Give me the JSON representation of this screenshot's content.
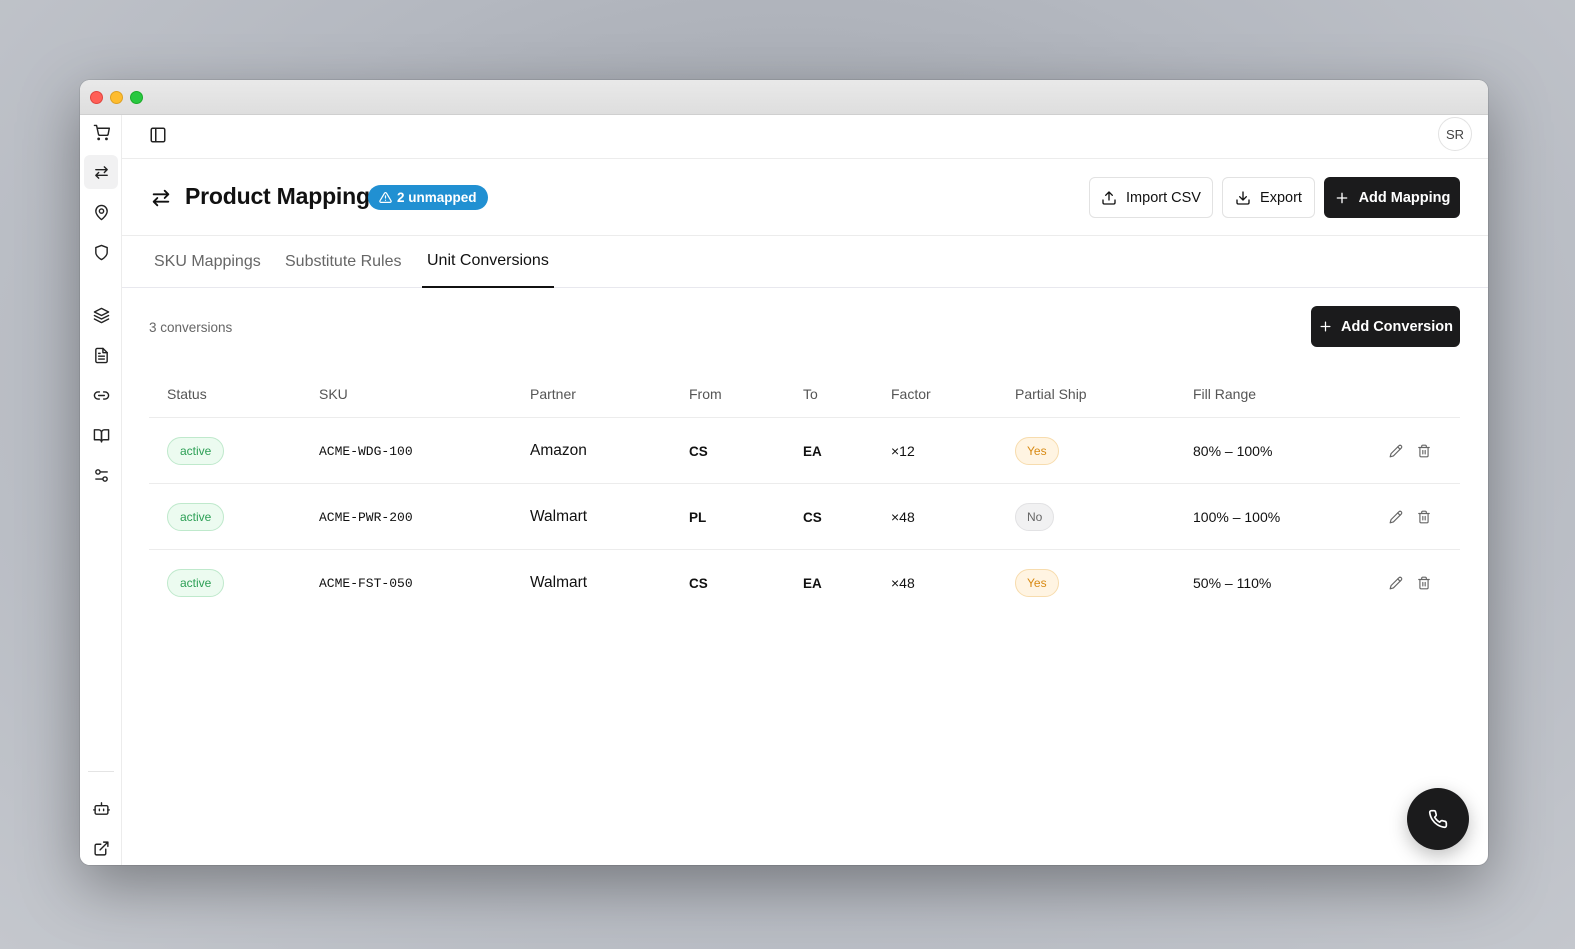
{
  "window": {
    "traffic_lights": [
      "close",
      "minimize",
      "maximize"
    ]
  },
  "sidebar": {
    "items": [
      {
        "icon": "cart-icon",
        "active": false
      },
      {
        "icon": "arrows-swap-icon",
        "active": true
      },
      {
        "icon": "map-pin-icon",
        "active": false
      },
      {
        "icon": "shield-icon",
        "active": false
      },
      {
        "icon": "layers-icon",
        "active": false
      },
      {
        "icon": "document-icon",
        "active": false
      },
      {
        "icon": "link-icon",
        "active": false
      },
      {
        "icon": "book-icon",
        "active": false
      },
      {
        "icon": "sliders-icon",
        "active": false
      },
      {
        "icon": "bot-icon",
        "active": false
      },
      {
        "icon": "external-link-icon",
        "active": false
      }
    ]
  },
  "topbar": {
    "avatar_initials": "SR"
  },
  "header": {
    "title": "Product Mapping",
    "unmapped_badge": "2 unmapped",
    "import_label": "Import CSV",
    "export_label": "Export",
    "add_mapping_label": "Add Mapping"
  },
  "tabs": [
    {
      "label": "SKU Mappings",
      "active": false
    },
    {
      "label": "Substitute Rules",
      "active": false
    },
    {
      "label": "Unit Conversions",
      "active": true
    }
  ],
  "conversions": {
    "count_label": "3 conversions",
    "add_label": "Add Conversion",
    "columns": [
      "Status",
      "SKU",
      "Partner",
      "From",
      "To",
      "Factor",
      "Partial Ship",
      "Fill Range"
    ],
    "rows": [
      {
        "status": "active",
        "sku": "ACME-WDG-100",
        "partner": "Amazon",
        "from": "CS",
        "to": "EA",
        "factor": "×12",
        "partial_ship": "Yes",
        "fill_range": "80% – 100%"
      },
      {
        "status": "active",
        "sku": "ACME-PWR-200",
        "partner": "Walmart",
        "from": "PL",
        "to": "CS",
        "factor": "×48",
        "partial_ship": "No",
        "fill_range": "100% – 100%"
      },
      {
        "status": "active",
        "sku": "ACME-FST-050",
        "partner": "Walmart",
        "from": "CS",
        "to": "EA",
        "factor": "×48",
        "partial_ship": "Yes",
        "fill_range": "50% – 110%"
      }
    ]
  },
  "colors": {
    "accent_badge": "#2190d2",
    "dark_button": "#1b1b1c",
    "status_green": "#2c9f55",
    "yes_orange": "#d88a14"
  }
}
